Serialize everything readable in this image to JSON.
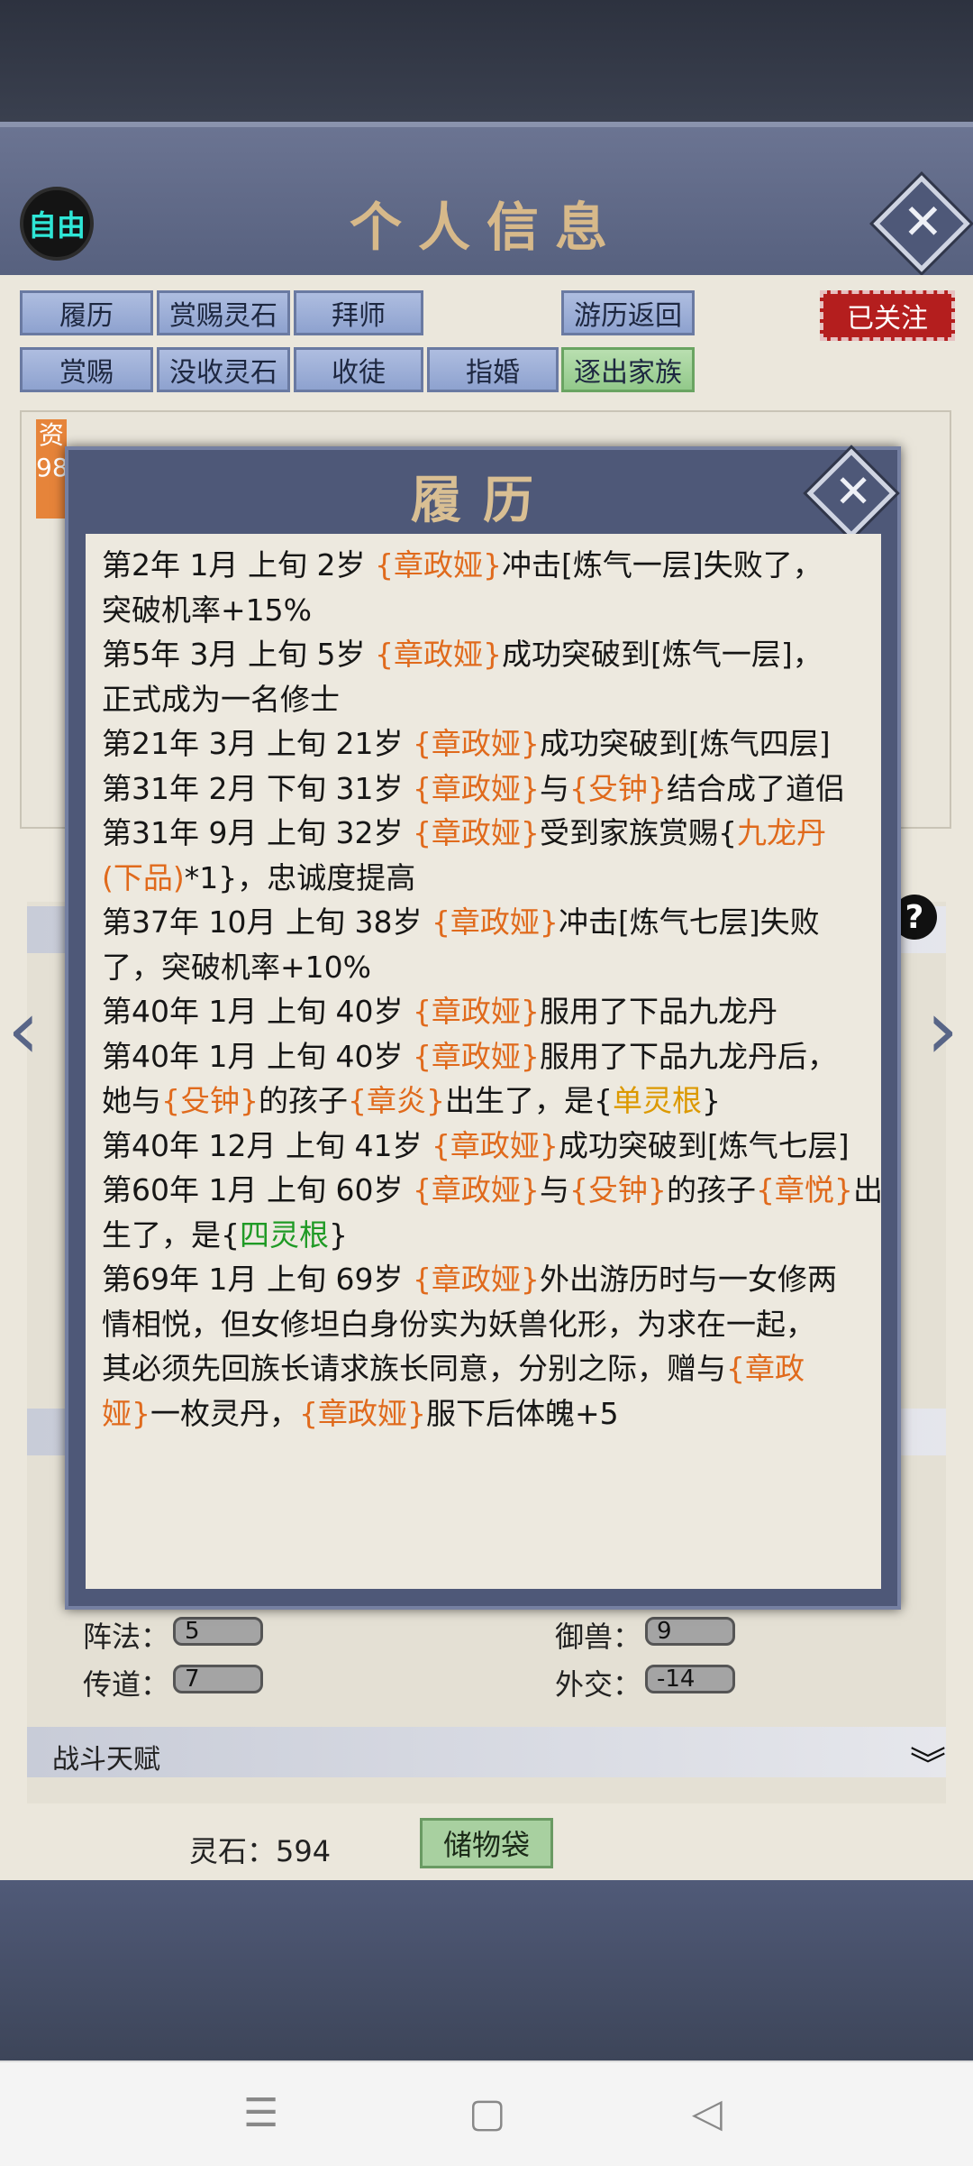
{
  "header": {
    "title": "个人信息",
    "free_badge": "自由"
  },
  "action_buttons": {
    "row1": [
      "履历",
      "赏赐灵石",
      "拜师",
      "游历返回"
    ],
    "row2": [
      "赏赐",
      "没收灵石",
      "收徒",
      "指婚",
      "逐出家族"
    ],
    "followed": "已关注"
  },
  "under_tag": "资\n98",
  "stats": [
    {
      "label": "阵法：",
      "value": "5"
    },
    {
      "label": "御兽：",
      "value": "9"
    },
    {
      "label": "传道：",
      "value": "7"
    },
    {
      "label": "外交：",
      "value": "-14"
    }
  ],
  "combat_section": "战斗天赋",
  "footer": {
    "stones": "灵石：594",
    "bag_button": "储物袋"
  },
  "modal": {
    "title": "履历",
    "lines": [
      [
        [
          "第2年 1月 上旬  2岁 ",
          ""
        ],
        [
          "{章政娅}",
          "o"
        ],
        [
          "冲击[炼气一层]失败了，",
          ""
        ]
      ],
      [
        [
          "突破机率+15%",
          ""
        ]
      ],
      [
        [
          "第5年 3月 上旬  5岁 ",
          ""
        ],
        [
          "{章政娅}",
          "o"
        ],
        [
          "成功突破到[炼气一层]，",
          ""
        ]
      ],
      [
        [
          "正式成为一名修士",
          ""
        ]
      ],
      [
        [
          "第21年 3月 上旬  21岁 ",
          ""
        ],
        [
          "{章政娅}",
          "o"
        ],
        [
          "成功突破到[炼气四层]",
          ""
        ]
      ],
      [
        [
          "第31年 2月 下旬  31岁 ",
          ""
        ],
        [
          "{章政娅}",
          "o"
        ],
        [
          "与",
          ""
        ],
        [
          "{殳钟}",
          "o"
        ],
        [
          "结合成了道侣",
          ""
        ]
      ],
      [
        [
          "第31年 9月 上旬  32岁 ",
          ""
        ],
        [
          "{章政娅}",
          "o"
        ],
        [
          "受到家族赏赐{",
          ""
        ],
        [
          "九龙丹",
          "o"
        ]
      ],
      [
        [
          "(下品)",
          "o"
        ],
        [
          "*1}，忠诚度提高",
          ""
        ]
      ],
      [
        [
          "第37年 10月 上旬  38岁 ",
          ""
        ],
        [
          "{章政娅}",
          "o"
        ],
        [
          "冲击[炼气七层]失败",
          ""
        ]
      ],
      [
        [
          "了，突破机率+10%",
          ""
        ]
      ],
      [
        [
          "第40年 1月 上旬  40岁 ",
          ""
        ],
        [
          "{章政娅}",
          "o"
        ],
        [
          "服用了下品九龙丹",
          ""
        ]
      ],
      [
        [
          "第40年 1月 上旬 40岁 ",
          ""
        ],
        [
          "{章政娅}",
          "o"
        ],
        [
          "服用了下品九龙丹后，",
          ""
        ]
      ],
      [
        [
          "她与",
          ""
        ],
        [
          "{殳钟}",
          "o"
        ],
        [
          "的孩子",
          ""
        ],
        [
          "{章炎}",
          "o"
        ],
        [
          "出生了，是{",
          ""
        ],
        [
          "单灵根",
          "y"
        ],
        [
          "}",
          ""
        ]
      ],
      [
        [
          "第40年 12月 上旬 41岁 ",
          ""
        ],
        [
          "{章政娅}",
          "o"
        ],
        [
          "成功突破到[炼气七层]",
          ""
        ]
      ],
      [
        [
          "第60年 1月 上旬 60岁 ",
          ""
        ],
        [
          "{章政娅}",
          "o"
        ],
        [
          "与",
          ""
        ],
        [
          "{殳钟}",
          "o"
        ],
        [
          "的孩子",
          ""
        ],
        [
          "{章悦}",
          "o"
        ],
        [
          "出",
          ""
        ]
      ],
      [
        [
          "生了，是{",
          ""
        ],
        [
          "四灵根",
          "g"
        ],
        [
          "}",
          ""
        ]
      ],
      [
        [
          "第69年 1月 上旬 69岁 ",
          ""
        ],
        [
          "{章政娅}",
          "o"
        ],
        [
          "外出游历时与一女修两",
          ""
        ]
      ],
      [
        [
          "情相悦，但女修坦白身份实为妖兽化形，为求在一起，",
          ""
        ]
      ],
      [
        [
          "其必须先回族长请求族长同意，分别之际，赠与",
          ""
        ],
        [
          "{章政",
          "o"
        ]
      ],
      [
        [
          "娅}",
          "o"
        ],
        [
          "一枚灵丹，",
          ""
        ],
        [
          "{章政娅}",
          "o"
        ],
        [
          "服下后体魄+5",
          ""
        ]
      ]
    ]
  }
}
